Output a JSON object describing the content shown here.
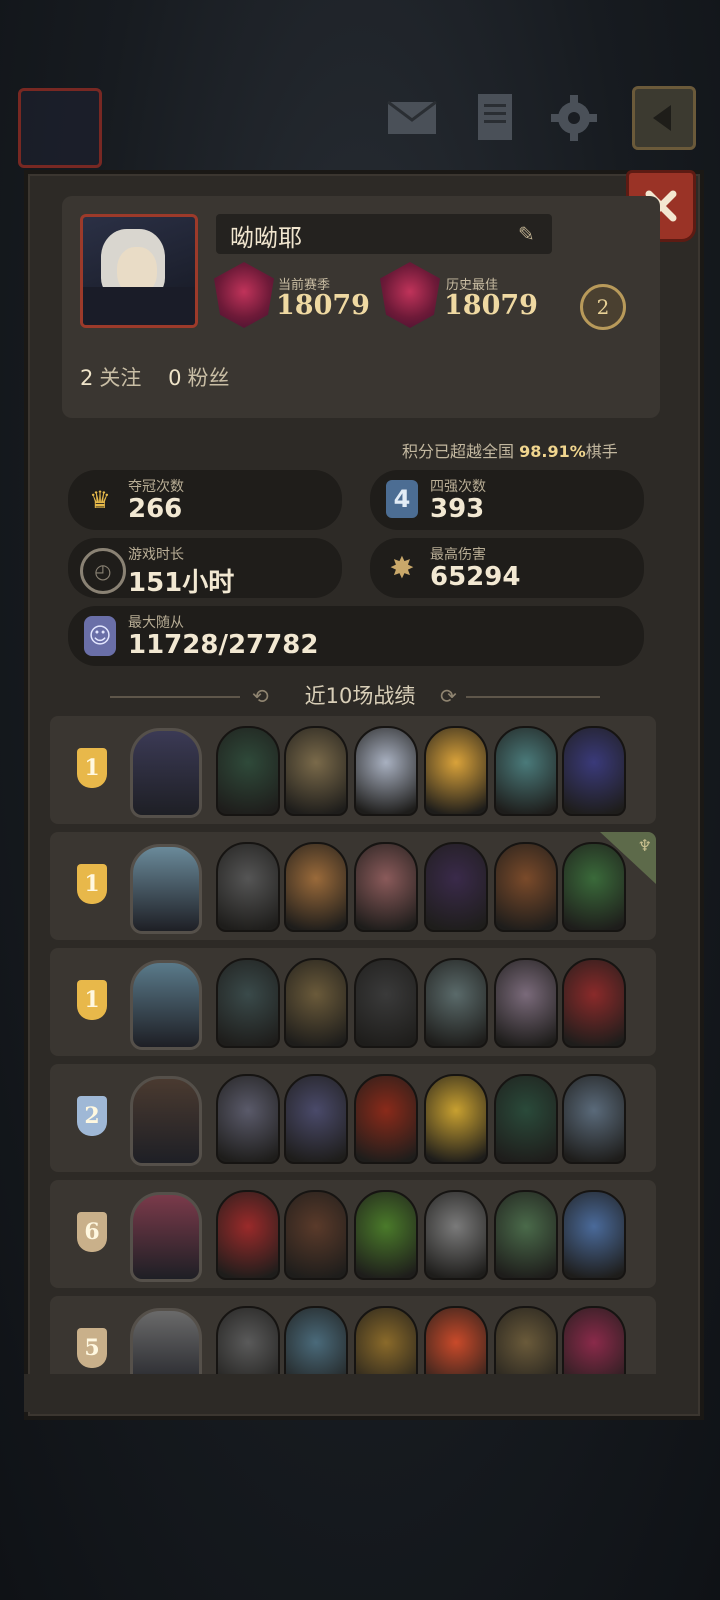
{
  "profile": {
    "name": "呦呦耶",
    "current_season_label": "当前赛季",
    "current_season_value": "18079",
    "best_label": "历史最佳",
    "best_value": "18079",
    "crown_level": "2",
    "following_count": "2",
    "following_label": "关注",
    "fans_count": "0",
    "fans_label": "粉丝"
  },
  "percent": {
    "prefix": "积分已超越全国",
    "value": "98.91%",
    "suffix": "棋手"
  },
  "stats": [
    {
      "label": "夺冠次数",
      "value": "266",
      "icon": "crown-icon"
    },
    {
      "label": "四强次数",
      "value": "393",
      "icon": "top-four-icon"
    },
    {
      "label": "游戏时长",
      "value": "151小时",
      "icon": "clock-icon"
    },
    {
      "label": "最高伤害",
      "value": "65294",
      "icon": "damage-burst-icon"
    },
    {
      "label": "最大随从",
      "value": "11728/27782",
      "icon": "minion-icon"
    }
  ],
  "section_title": "近10场战绩",
  "matches": [
    {
      "place": "1",
      "badge_color": "#e8b84a",
      "hero_color": "#3b3a55",
      "units": [
        "#2f4a3a",
        "#7a6a4a",
        "#a8b0c0",
        "#d9a23a",
        "#4a7a7a",
        "#3a3a7a"
      ],
      "tag": false
    },
    {
      "place": "1",
      "badge_color": "#e8b84a",
      "hero_color": "#6a8a9a",
      "units": [
        "#555555",
        "#9a6a3a",
        "#8a5a5a",
        "#3a2a4a",
        "#7a4a2a",
        "#3a6a3a"
      ],
      "tag": true
    },
    {
      "place": "1",
      "badge_color": "#e8b84a",
      "hero_color": "#5a7a8a",
      "units": [
        "#3a4a4a",
        "#6a5a3a",
        "#3a3a3a",
        "#5a6a6a",
        "#7a6a7a",
        "#8a2a2a"
      ],
      "tag": false
    },
    {
      "place": "2",
      "badge_color": "#9fb8d6",
      "hero_color": "#4a3a30",
      "units": [
        "#5a5a6a",
        "#4a4a6a",
        "#8a2a1a",
        "#c8a030",
        "#2a4a3a",
        "#5a6a7a"
      ],
      "tag": false
    },
    {
      "place": "6",
      "badge_color": "#c9b08a",
      "hero_color": "#7a3a4a",
      "units": [
        "#9a2a2a",
        "#5a3a2a",
        "#4a7a2a",
        "#7a7a7a",
        "#4a6a4a",
        "#4a6a9a"
      ],
      "tag": false
    },
    {
      "place": "5",
      "badge_color": "#c9b08a",
      "hero_color": "#6a6a6a",
      "units": [
        "#5a5a5a",
        "#4a6a7a",
        "#8a6a2a",
        "#c94a2a",
        "#6a5a3a",
        "#8a2a4a"
      ],
      "tag": false
    }
  ],
  "corner_tag_icon": "goblet-icon"
}
